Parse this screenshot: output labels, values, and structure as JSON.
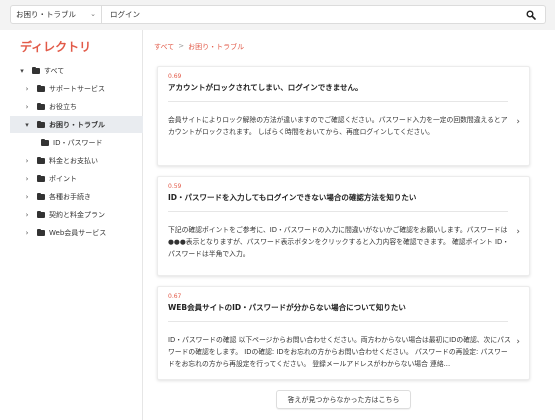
{
  "search": {
    "category": "お困り・トラブル",
    "query": "ログイン"
  },
  "sidebar": {
    "title": "ディレクトリ",
    "items": [
      {
        "label": "すべて",
        "arrow": "▾"
      },
      {
        "label": "サポートサービス",
        "arrow": "›"
      },
      {
        "label": "お役立ち",
        "arrow": "›"
      },
      {
        "label": "お困り・トラブル",
        "arrow": "▾"
      },
      {
        "label": "ID・パスワード",
        "arrow": ""
      },
      {
        "label": "料金とお支払い",
        "arrow": "›"
      },
      {
        "label": "ポイント",
        "arrow": "›"
      },
      {
        "label": "各種お手続き",
        "arrow": "›"
      },
      {
        "label": "契約と料金プラン",
        "arrow": "›"
      },
      {
        "label": "Web会員サービス",
        "arrow": "›"
      }
    ]
  },
  "breadcrumb": {
    "root": "すべて",
    "separator": ">",
    "current": "お困り・トラブル"
  },
  "results": [
    {
      "score": "0.69",
      "title": "アカウントがロックされてしまい、ログインできません。",
      "body": "会員サイトによりロック解除の方法が違いますのでご確認ください。パスワード入力を一定の回数間違えるとアカウントがロックされます。 しばらく時間をおいてから、再度ログインしてください。"
    },
    {
      "score": "0.59",
      "title": "ID・パスワードを入力してもログインできない場合の確認方法を知りたい",
      "body": "下記の確認ポイントをご参考に、ID・パスワードの入力に間違いがないかご確認をお願いします。パスワードは●●●表示となりますが、パスワード表示ボタンをクリックすると入力内容を確認できます。 確認ポイント ID・パスワードは半角で入力。"
    },
    {
      "score": "0.67",
      "title": "WEB会員サイトのID・パスワードが分からない場合について知りたい",
      "body": "ID・パスワードの確認 以下ページからお問い合わせください。両方わからない場合は最初にIDの確認、次にパスワードの確認をします。 IDの確認: IDをお忘れの方からお問い合わせください。 パスワードの再設定: パスワードをお忘れの方から再設定を行ってください。 登録メールアドレスがわからない場合 連絡..."
    }
  ],
  "footer": {
    "not_found_label": "答えが見つからなかった方はこちら"
  },
  "colors": {
    "accent": "#e25a48",
    "active_bg": "#e9ecf0"
  },
  "icons": {
    "search": "magnifier",
    "folder": "folder",
    "expand": "chevron"
  }
}
